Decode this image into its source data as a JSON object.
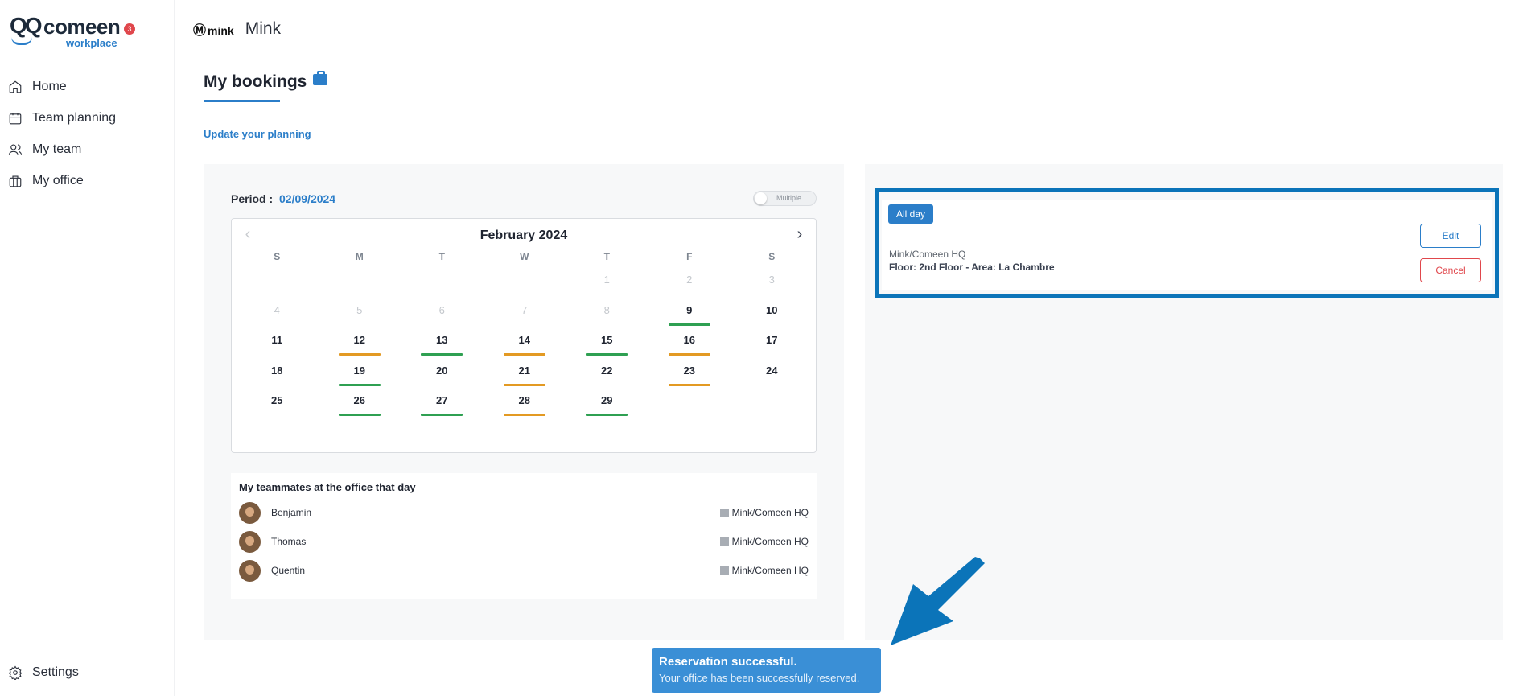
{
  "app": {
    "logo_word": "comeen",
    "logo_sub": "workplace",
    "notification_count": "3"
  },
  "sidebar": {
    "items": [
      {
        "label": "Home",
        "icon": "home-icon"
      },
      {
        "label": "Team planning",
        "icon": "calendar-icon"
      },
      {
        "label": "My team",
        "icon": "users-icon"
      },
      {
        "label": "My office",
        "icon": "building-icon"
      }
    ],
    "settings_label": "Settings"
  },
  "header": {
    "company_logo": "mink",
    "company_name": "Mink"
  },
  "page": {
    "title": "My bookings",
    "update_link": "Update your planning"
  },
  "period": {
    "label": "Period :",
    "value": "02/09/2024",
    "toggle_label": "Multiple",
    "toggle_on": false
  },
  "calendar": {
    "month_title": "February 2024",
    "weekdays": [
      "S",
      "M",
      "T",
      "W",
      "T",
      "F",
      "S"
    ],
    "colors": {
      "green": "#2fa052",
      "orange": "#e39a23"
    },
    "weeks": [
      [
        {
          "d": ""
        },
        {
          "d": ""
        },
        {
          "d": ""
        },
        {
          "d": ""
        },
        {
          "d": "1",
          "muted": true
        },
        {
          "d": "2",
          "muted": true
        },
        {
          "d": "3",
          "muted": true
        }
      ],
      [
        {
          "d": "4",
          "muted": true
        },
        {
          "d": "5",
          "muted": true
        },
        {
          "d": "6",
          "muted": true
        },
        {
          "d": "7",
          "muted": true
        },
        {
          "d": "8",
          "muted": true
        },
        {
          "d": "9",
          "bar": "green"
        },
        {
          "d": "10"
        }
      ],
      [
        {
          "d": "11"
        },
        {
          "d": "12",
          "bar": "orange"
        },
        {
          "d": "13",
          "bar": "green"
        },
        {
          "d": "14",
          "bar": "orange"
        },
        {
          "d": "15",
          "bar": "green"
        },
        {
          "d": "16",
          "bar": "orange"
        },
        {
          "d": "17"
        }
      ],
      [
        {
          "d": "18"
        },
        {
          "d": "19",
          "bar": "green"
        },
        {
          "d": "20"
        },
        {
          "d": "21",
          "bar": "orange"
        },
        {
          "d": "22"
        },
        {
          "d": "23",
          "bar": "orange"
        },
        {
          "d": "24"
        }
      ],
      [
        {
          "d": "25"
        },
        {
          "d": "26",
          "bar": "green"
        },
        {
          "d": "27",
          "bar": "green"
        },
        {
          "d": "28",
          "bar": "orange"
        },
        {
          "d": "29",
          "bar": "green"
        },
        {
          "d": ""
        },
        {
          "d": ""
        }
      ]
    ]
  },
  "teammates": {
    "title": "My teammates at the office that day",
    "list": [
      {
        "name": "Benjamin",
        "location": "Mink/Comeen HQ"
      },
      {
        "name": "Thomas",
        "location": "Mink/Comeen HQ"
      },
      {
        "name": "Quentin",
        "location": "Mink/Comeen HQ"
      }
    ]
  },
  "booking": {
    "badge": "All day",
    "site": "Mink/Comeen HQ",
    "floor": "Floor: 2nd Floor - Area: La Chambre",
    "edit_label": "Edit",
    "cancel_label": "Cancel"
  },
  "toast": {
    "title": "Reservation successful.",
    "message": "Your office has been successfully reserved."
  }
}
